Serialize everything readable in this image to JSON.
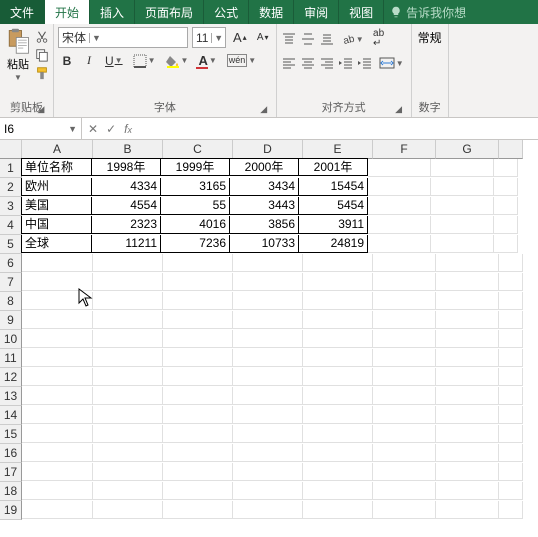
{
  "tabs": {
    "file": "文件",
    "home": "开始",
    "insert": "插入",
    "layout": "页面布局",
    "formula": "公式",
    "data": "数据",
    "review": "审阅",
    "view": "视图",
    "tell": "告诉我你想"
  },
  "clipboard": {
    "paste": "粘贴",
    "label": "剪贴板"
  },
  "font": {
    "name": "宋体",
    "size": "11",
    "label": "字体",
    "bold": "B",
    "italic": "I",
    "underline": "U",
    "phonetic": "wén"
  },
  "sizebtn": {
    "inc": "A",
    "dec": "A"
  },
  "align": {
    "label": "对齐方式",
    "wrap": "ab"
  },
  "number": {
    "label": "数字",
    "format": "常规"
  },
  "cellref": "I6",
  "cols": [
    "A",
    "B",
    "C",
    "D",
    "E",
    "F",
    "G",
    ""
  ],
  "table": {
    "headers": [
      "单位名称",
      "1998年",
      "1999年",
      "2000年",
      "2001年"
    ],
    "rows": [
      {
        "name": "欧州",
        "vals": [
          "4334",
          "3165",
          "3434",
          "15454"
        ]
      },
      {
        "name": "美国",
        "vals": [
          "4554",
          "55",
          "3443",
          "5454"
        ]
      },
      {
        "name": "中国",
        "vals": [
          "2323",
          "4016",
          "3856",
          "3911"
        ]
      },
      {
        "name": "全球",
        "vals": [
          "11211",
          "7236",
          "10733",
          "24819"
        ]
      }
    ]
  }
}
